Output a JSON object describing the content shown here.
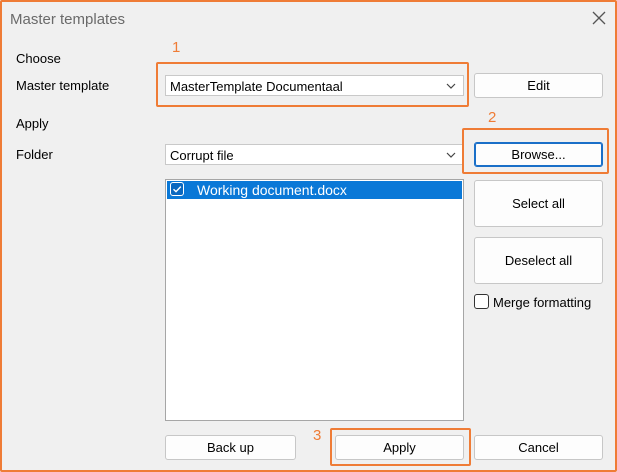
{
  "window": {
    "title": "Master templates"
  },
  "choose": {
    "section_label": "Choose",
    "master_template_label": "Master template",
    "master_template_value": "MasterTemplate Documentaal",
    "edit_label": "Edit"
  },
  "apply_section": {
    "section_label": "Apply",
    "folder_label": "Folder",
    "folder_value": "Corrupt file",
    "browse_label": "Browse..."
  },
  "documents": {
    "items": [
      {
        "name": "Working document.docx",
        "checked": true
      }
    ]
  },
  "side_buttons": {
    "select_all": "Select all",
    "deselect_all": "Deselect all",
    "merge_formatting": "Merge formatting",
    "merge_formatting_checked": false
  },
  "footer": {
    "back_up": "Back up",
    "apply": "Apply",
    "cancel": "Cancel"
  },
  "callouts": [
    "1",
    "2",
    "3"
  ],
  "colors": {
    "callout": "#ef7c36",
    "selection": "#0a78d7",
    "focus": "#1a6fc8"
  }
}
